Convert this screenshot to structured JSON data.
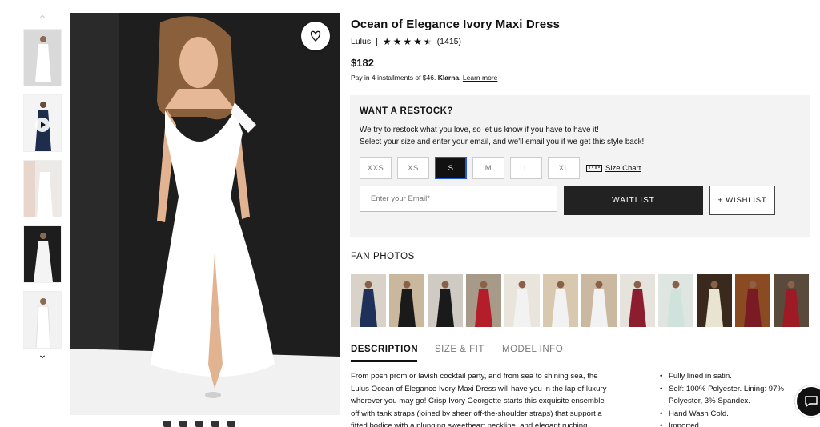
{
  "product": {
    "title": "Ocean of Elegance Ivory Maxi Dress",
    "brand": "Lulus",
    "separator": "|",
    "rating": 4.5,
    "review_count": "(1415)",
    "price": "$182",
    "klarna_text": "Pay in 4 installments of $46.",
    "klarna_brand": "Klarna.",
    "klarna_link": "Learn more"
  },
  "restock": {
    "title": "WANT A RESTOCK?",
    "line1": "We try to restock what you love, so let us know if you have to have it!",
    "line2": "Select your size and enter your email, and we'll email you if we get this style back!",
    "sizes": [
      "XXS",
      "XS",
      "S",
      "M",
      "L",
      "XL"
    ],
    "selected_size": "S",
    "size_chart": "Size Chart",
    "email_placeholder": "Enter your Email*",
    "waitlist": "WAITLIST",
    "wishlist": "+ WISHLIST"
  },
  "fan_photos": {
    "title": "FAN PHOTOS",
    "dress_colors": [
      "#1f3158",
      "#1a1a1a",
      "#1a1a1a",
      "#b31e2a",
      "#f2f2f2",
      "#f2f2f2",
      "#f2f2f2",
      "#8c1d2e",
      "#cfe3dc",
      "#e9e3d2",
      "#7a1a25",
      "#9e1a24"
    ]
  },
  "tabs": {
    "description": "DESCRIPTION",
    "size_fit": "SIZE & FIT",
    "model_info": "MODEL INFO"
  },
  "description": {
    "line1": "From posh prom or lavish cocktail party, and from sea to shining sea, the",
    "line2": "Lulus Ocean of Elegance Ivory Maxi Dress will have you in the lap of luxury",
    "line3": "wherever you may go! Crisp Ivory Georgette starts this exquisite ensemble",
    "line4": "off with tank straps (joined by sheer off-the-shoulder straps) that support a",
    "line5": "fitted bodice with a plunging sweetheart neckline, and elegant ruching."
  },
  "details": {
    "b1": "Fully lined in satin.",
    "b2a": "Self: 100% Polyester. Lining: 97%",
    "b2b": "Polyester, 3% Spandex.",
    "b3": "Hand Wash Cold.",
    "b4": "Imported."
  },
  "icons": {
    "favorite": "heart-icon",
    "chat": "chat-icon",
    "scroll_up": "chevron-up-icon",
    "scroll_down": "chevron-down-icon",
    "ruler": "ruler-icon"
  }
}
